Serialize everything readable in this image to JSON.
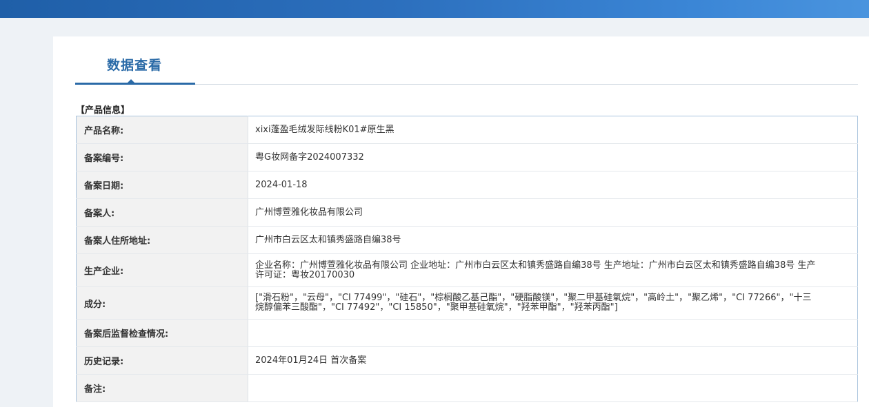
{
  "page": {
    "tab_title": "数据查看",
    "section_title": "【产品信息】"
  },
  "colors": {
    "header_gradient_start": "#1f5fa8",
    "header_gradient_end": "#4a94de",
    "accent": "#2a6aa7",
    "label_bg": "#f2f2f2",
    "table_border": "#a9c4dd"
  },
  "product_info": {
    "rows": [
      {
        "label": "产品名称:",
        "value": "xixi蓬盈毛绒发际线粉K01#原生黑"
      },
      {
        "label": "备案编号:",
        "value": "粤G妆网备字2024007332"
      },
      {
        "label": "备案日期:",
        "value": "2024-01-18"
      },
      {
        "label": "备案人:",
        "value": "广州博萱雅化妆品有限公司"
      },
      {
        "label": "备案人住所地址:",
        "value": "广州市白云区太和镇秀盛路自编38号"
      },
      {
        "label": "生产企业:",
        "value": "企业名称：广州博萱雅化妆品有限公司 企业地址：广州市白云区太和镇秀盛路自编38号 生产地址：广州市白云区太和镇秀盛路自编38号 生产许可证：粤妆20170030"
      },
      {
        "label": "成分:",
        "value": "[\"滑石粉\"，\"云母\"，\"CI 77499\"，\"硅石\"，\"棕榈酸乙基己酯\"，\"硬脂酸镁\"，\"聚二甲基硅氧烷\"，\"高岭土\"，\"聚乙烯\"，\"CI 77266\"，\"十三烷醇偏苯三酸酯\"，\"CI 77492\"，\"CI 15850\"，\"聚甲基硅氧烷\"，\"羟苯甲酯\"，\"羟苯丙酯\"]"
      },
      {
        "label": "备案后监督检查情况:",
        "value": ""
      },
      {
        "label": "历史记录:",
        "value": "2024年01月24日 首次备案"
      },
      {
        "label": "备注:",
        "value": ""
      }
    ]
  }
}
